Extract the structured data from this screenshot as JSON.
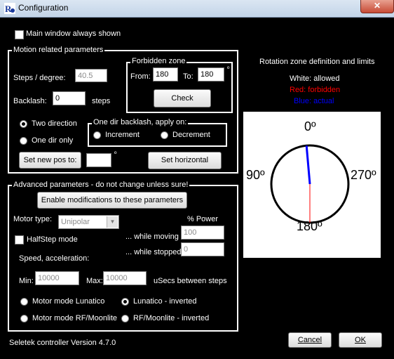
{
  "window": {
    "title": "Configuration",
    "close_glyph": "✕"
  },
  "main_window_always_shown": {
    "label": "Main window always shown",
    "checked": false
  },
  "motion": {
    "group_label": "Motion related parameters",
    "steps_label": "Steps / degree:",
    "steps_value": "40.5",
    "backlash_label": "Backlash:",
    "backlash_value": "0",
    "backlash_unit": "steps",
    "forbidden": {
      "group_label": "Forbidden zone",
      "from_label": "From:",
      "from_value": "180",
      "to_label": "To:",
      "to_value": "180",
      "degree_mark": "º",
      "check_button": "Check"
    },
    "two_direction": "Two direction",
    "one_dir_only": "One dir only",
    "direction_selected": "two",
    "one_dir_backlash": {
      "group_label": "One dir backlash, apply on:",
      "increment": "Increment",
      "decrement": "Decrement",
      "selected": "none"
    },
    "set_new_pos_button": "Set new pos to:",
    "new_pos_value": "",
    "new_pos_degree_mark": "º",
    "set_horizontal_button": "Set horizontal"
  },
  "advanced": {
    "group_label": "Advanced parameters - do not change unless sure!",
    "enable_button": "Enable modifications to these parameters",
    "motor_type_label": "Motor type:",
    "motor_type_value": "Unipolar",
    "power_header": "% Power",
    "halfstep_label": "HalfStep mode",
    "halfstep_checked": false,
    "while_moving_label": "... while moving",
    "while_moving_value": "100",
    "while_stopped_label": "... while stopped",
    "while_stopped_value": "0",
    "speed_label": "Speed, acceleration:",
    "min_label": "Min:",
    "min_value": "10000",
    "max_label": "Max:",
    "max_value": "10000",
    "usecs_label": "uSecs between steps",
    "motor_modes": [
      "Motor mode Lunatico",
      "Lunatico - inverted",
      "Motor mode RF/Moonlite",
      "RF/Moonlite - inverted"
    ],
    "motor_mode_selected": 1
  },
  "rotation": {
    "title": "Rotation zone definition and limits",
    "white_legend": "White: allowed",
    "red_legend": "Red: forbidden",
    "blue_legend": "Blue: actual",
    "red_color": "#ff0000",
    "blue_color": "#0000ff",
    "label_top": "0º",
    "label_left": "90º",
    "label_right": "270º",
    "label_bottom": "180º",
    "actual_position_deg": 5,
    "forbidden_marker_deg": 180
  },
  "footer": {
    "version": "Seletek controller Version 4.7.0",
    "cancel_button": "Cancel",
    "ok_button": "OK"
  }
}
